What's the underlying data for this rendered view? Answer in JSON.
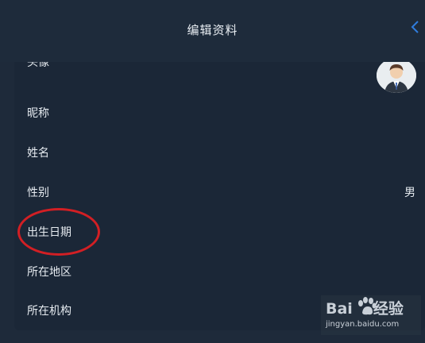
{
  "header": {
    "title": "编辑资料",
    "back_icon": "chevron-left-icon"
  },
  "rows": [
    {
      "label": "头像",
      "value": ""
    },
    {
      "label": "昵称",
      "value": ""
    },
    {
      "label": "姓名",
      "value": ""
    },
    {
      "label": "性别",
      "value": "男"
    },
    {
      "label": "出生日期",
      "value": ""
    },
    {
      "label": "所在地区",
      "value": ""
    },
    {
      "label": "所在机构",
      "value": ""
    }
  ],
  "annotation": {
    "color": "#d21f24"
  },
  "watermark": {
    "brand_left": "Bai",
    "brand_right": "经验",
    "url": "jingyan.baidu.com"
  },
  "colors": {
    "background": "#1e2a3a",
    "card": "#1b2737",
    "accent": "#2f7dde"
  }
}
